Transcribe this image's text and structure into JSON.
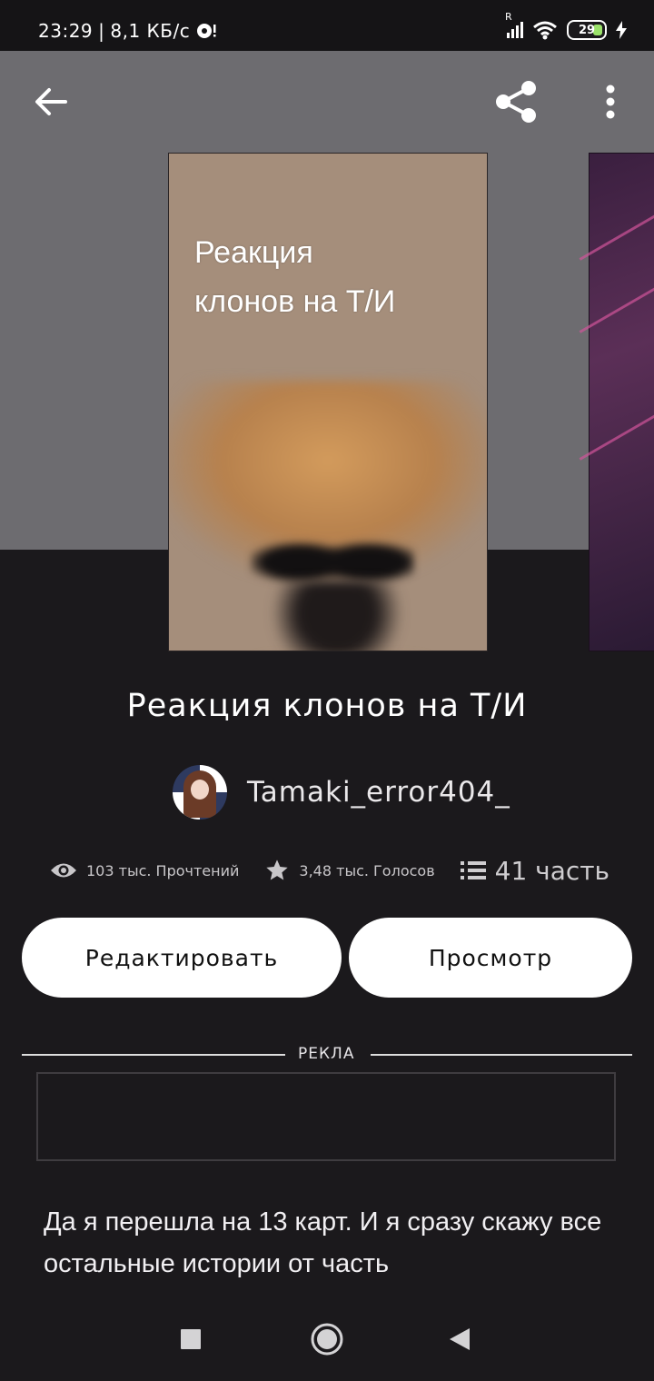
{
  "status_bar": {
    "time": "23:29",
    "speed": "8,1 КБ/с",
    "signal_label": "R",
    "battery": "29",
    "battery_color": "#9be26a"
  },
  "topbar": {
    "back_icon": "arrow-left-icon",
    "share_icon": "share-icon",
    "more_icon": "more-vertical-icon"
  },
  "cover": {
    "text": "Реакция\nклонов на Т/И"
  },
  "book": {
    "title": "Реакция клонов на Т/И",
    "author": "Tamaki_error404_",
    "reads": "103 тыс. Прочтений",
    "votes": "3,48 тыс. Голосов",
    "parts": "41 часть"
  },
  "buttons": {
    "edit": "Редактировать",
    "preview": "Просмотр"
  },
  "ad": {
    "label": "РЕКЛА"
  },
  "description": "Да я перешла на 13 карт. И я сразу скажу все остальные истории от часть",
  "colors": {
    "background": "#1b191c",
    "header": "#6d6c70",
    "button": "#ffffff"
  }
}
